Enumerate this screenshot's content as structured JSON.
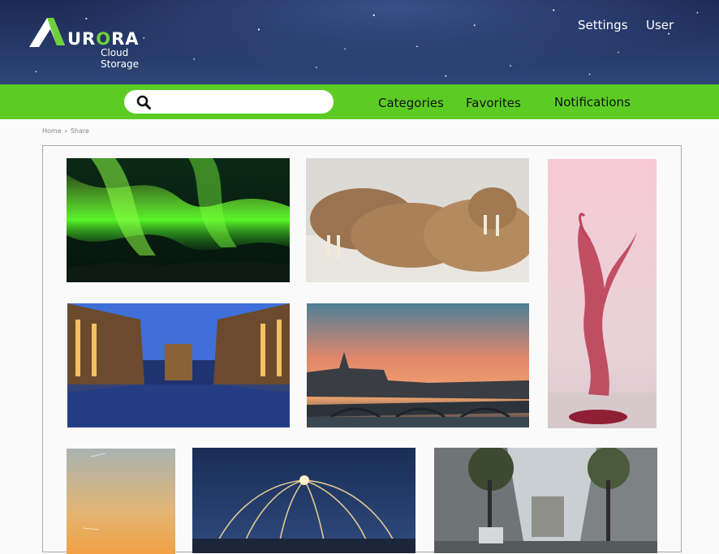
{
  "brand": {
    "name_prefix": "UR",
    "name_accent": "O",
    "name_suffix": "RA",
    "subtitle": "Cloud Storage",
    "accent_color": "#6fd13a"
  },
  "header_links": {
    "settings": "Settings",
    "user": "User"
  },
  "search": {
    "placeholder": "",
    "value": "",
    "icon": "search-icon"
  },
  "nav": {
    "categories": "Categories",
    "favorites": "Favorites",
    "notifications": "Notifications"
  },
  "breadcrumb": {
    "home": "Home",
    "current": "Share"
  },
  "photos": [
    {
      "subject": "aurora borealis"
    },
    {
      "subject": "walruses on sand"
    },
    {
      "subject": "red liquid splash"
    },
    {
      "subject": "canal warehouses at dusk"
    },
    {
      "subject": "bridge and castle at sunset"
    },
    {
      "subject": "evening sky"
    },
    {
      "subject": "steel wool light painting"
    },
    {
      "subject": "city street with trees"
    }
  ],
  "colors": {
    "nav_green": "#5ccc25",
    "header_navy": "#243664"
  }
}
